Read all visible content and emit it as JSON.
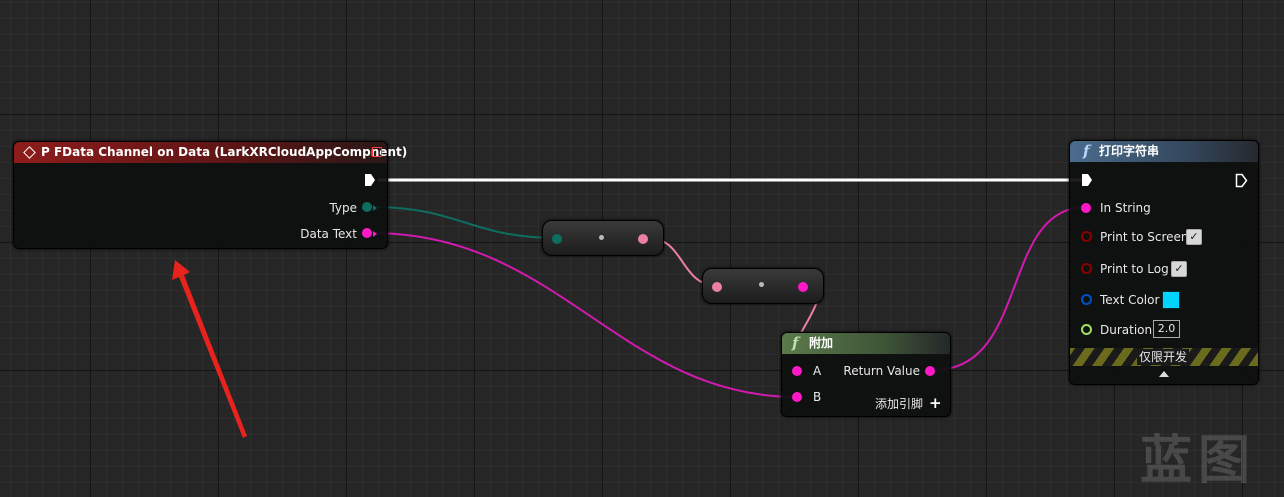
{
  "event_node": {
    "title": "P FData Channel on Data (LarkXRCloudAppCompnent)",
    "pins": {
      "type": "Type",
      "data_text": "Data Text"
    }
  },
  "print_node": {
    "title": "打印字符串",
    "pins": {
      "in_string": "In String",
      "print_to_screen": "Print to Screen",
      "print_to_log": "Print to Log",
      "text_color": "Text Color",
      "duration": "Duration"
    },
    "values": {
      "print_to_screen": true,
      "print_to_log": true,
      "text_color": "#00d4ff",
      "duration": "2.0"
    },
    "dev_only": "仅限开发"
  },
  "append_node": {
    "title": "附加",
    "pins": {
      "a": "A",
      "b": "B",
      "return_value": "Return Value",
      "add_pin": "添加引脚"
    }
  },
  "watermark": "蓝图",
  "colors": {
    "string_pin": "#ff18c8",
    "byte_pin": "#0d6e60",
    "bool_pin": "#8c0000",
    "struct_pin": "#0050c8",
    "float_pin": "#a0e060",
    "pink_pin": "#ec7fa8",
    "annotation_arrow": "#e8231e"
  },
  "icons": [
    "event-diamond-icon",
    "function-f-icon",
    "exec-arrow-icon",
    "checkmark-icon",
    "plus-icon",
    "collapse-triangle-icon"
  ]
}
